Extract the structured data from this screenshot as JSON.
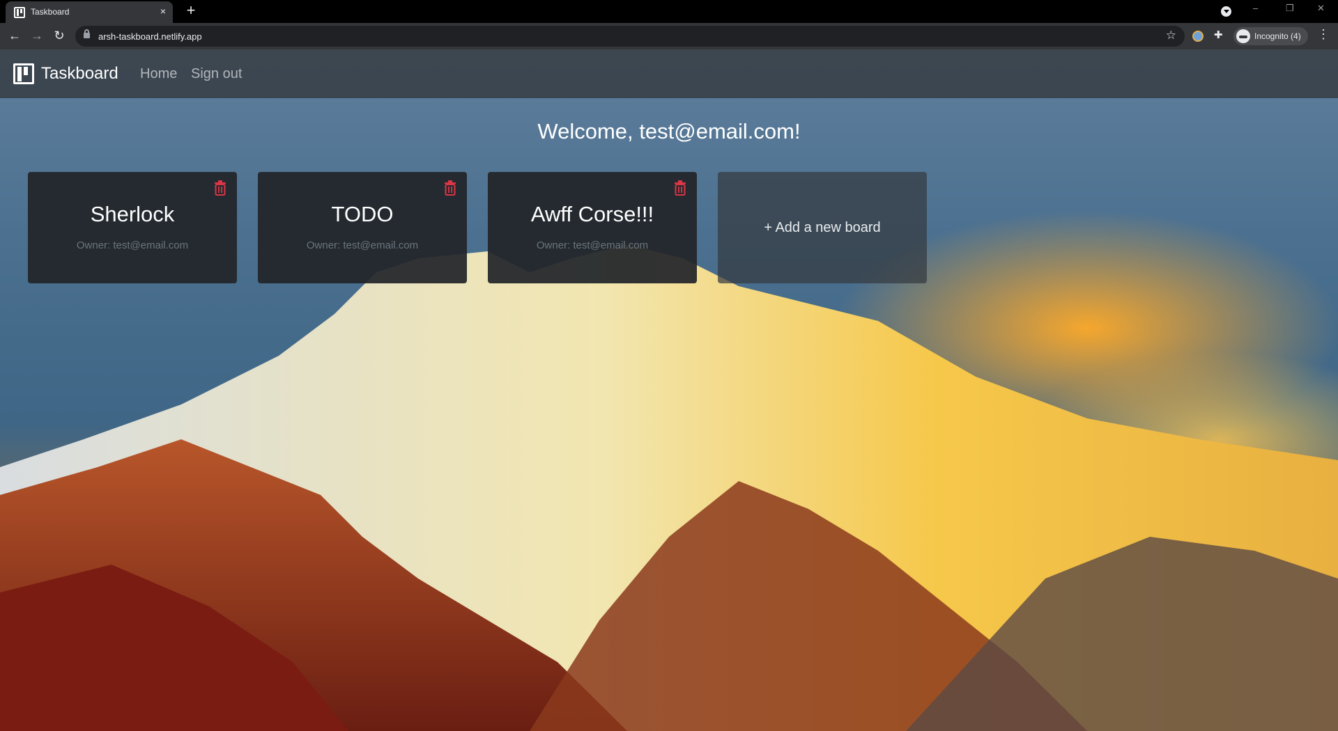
{
  "browser": {
    "tab_title": "Taskboard",
    "tab_close": "×",
    "new_tab": "+",
    "url": "arsh-taskboard.netlify.app",
    "profile_label": "Incognito (4)",
    "window_controls": {
      "minimize": "–",
      "restore": "❐",
      "close": "✕"
    },
    "nav": {
      "back": "←",
      "forward": "→",
      "reload": "↻"
    },
    "star": "☆",
    "menu": "⋮"
  },
  "navbar": {
    "brand": "Taskboard",
    "links": [
      {
        "label": "Home"
      },
      {
        "label": "Sign out"
      }
    ]
  },
  "welcome": "Welcome, test@email.com!",
  "boards": [
    {
      "title": "Sherlock",
      "owner": "Owner: test@email.com"
    },
    {
      "title": "TODO",
      "owner": "Owner: test@email.com"
    },
    {
      "title": "Awff Corse!!!",
      "owner": "Owner: test@email.com"
    }
  ],
  "add_board": "+ Add a new board",
  "colors": {
    "navbar": "#343a40",
    "card": "#212529",
    "trash": "#dc3545",
    "owner_text": "#6c757d"
  }
}
